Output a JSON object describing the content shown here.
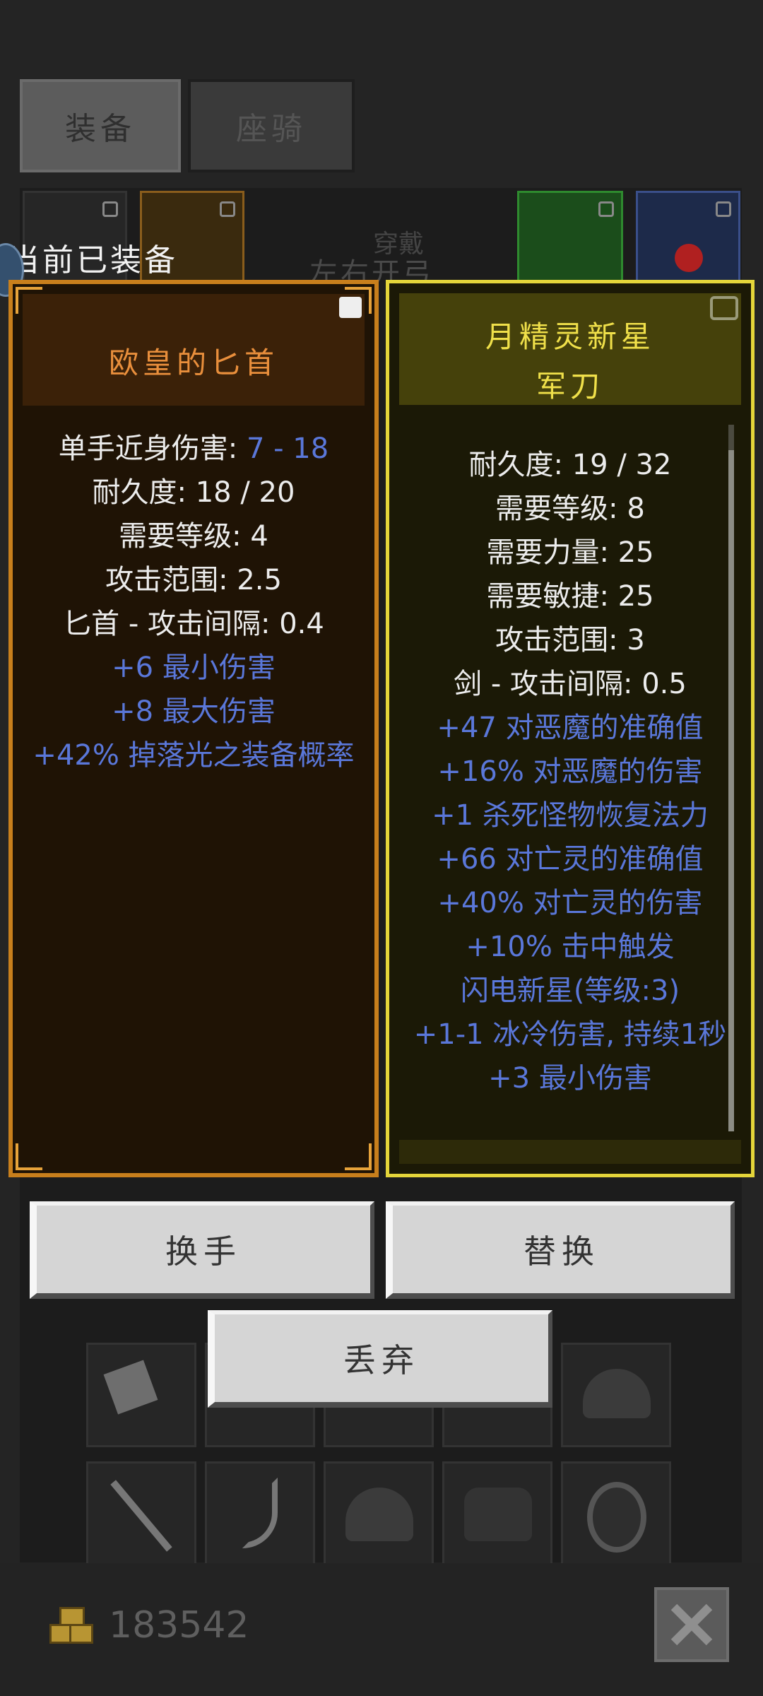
{
  "tabs": [
    {
      "label": "装备",
      "active": true
    },
    {
      "label": "座骑",
      "active": false
    }
  ],
  "equipped_label": "当前已装备",
  "background_overlay": {
    "text1": "左右开弓",
    "text2": "穿戴"
  },
  "equipped_item": {
    "title": "欧皇的匕首",
    "title_color": "#e98f3c",
    "stats": [
      {
        "label": "单手近身伤害: ",
        "value": "7 - 18"
      },
      {
        "text": "耐久度: 18 / 20"
      },
      {
        "text": "需要等级: 4"
      },
      {
        "text": "攻击范围: 2.5"
      },
      {
        "text": "匕首 - 攻击间隔: 0.4"
      }
    ],
    "bonuses": [
      "+6 最小伤害",
      "+8 最大伤害",
      "+42% 掉落光之装备概率"
    ]
  },
  "compared_item": {
    "title_line1": "月精灵新星",
    "title_line2": "军刀",
    "title_color": "#f0e04a",
    "stats": [
      "耐久度: 19 / 32",
      "需要等级: 8",
      "需要力量: 25",
      "需要敏捷: 25",
      "攻击范围: 3",
      "剑 - 攻击间隔: 0.5"
    ],
    "bonuses": [
      "+47 对恶魔的准确值",
      "+16% 对恶魔的伤害",
      "+1 杀死怪物恢复法力",
      "+66 对亡灵的准确值",
      "+40% 对亡灵的伤害",
      "+10% 击中触发",
      "闪电新星(等级:3)",
      "+1-1 冰冷伤害, 持续1秒",
      "+3 最小伤害"
    ]
  },
  "buttons": {
    "swap_hand": "换手",
    "replace": "替换",
    "discard": "丢弃"
  },
  "gold": "183542",
  "colors": {
    "bonus_blue": "#5a77d9",
    "equipped_border": "#c87f1c",
    "compare_border": "#e4d53a"
  }
}
